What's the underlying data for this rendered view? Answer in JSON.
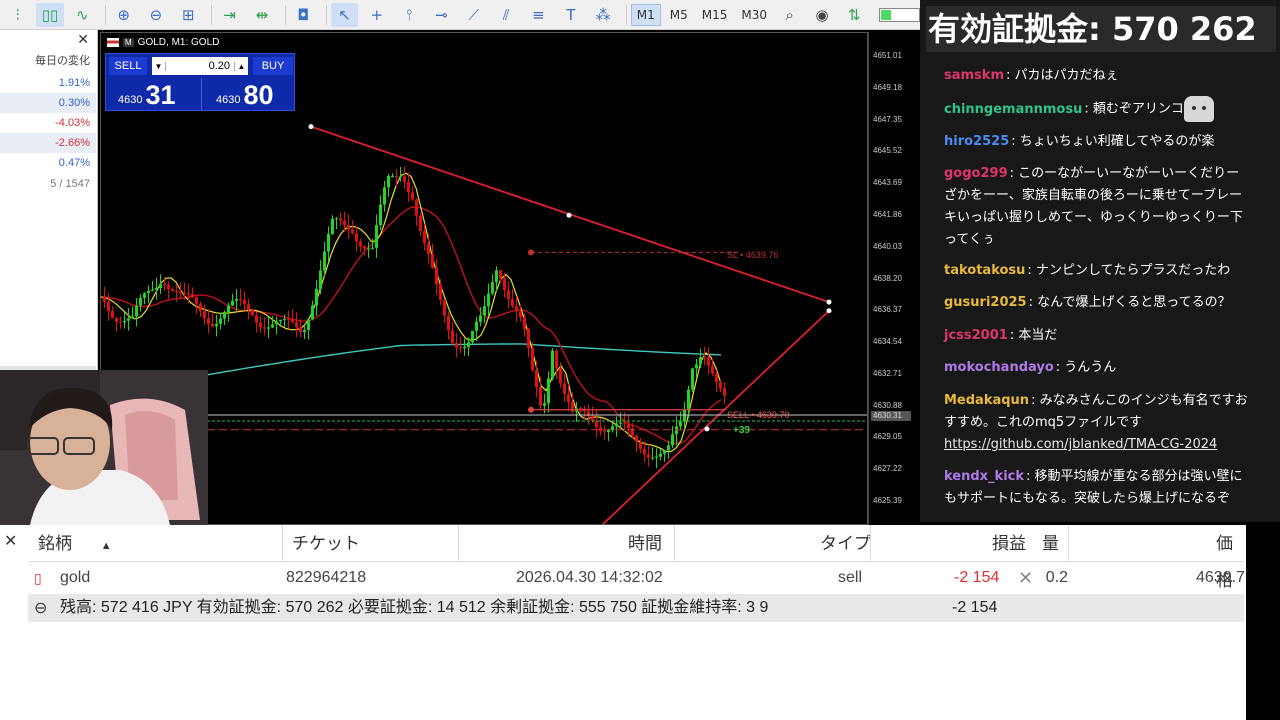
{
  "toolbar": {
    "timeframes": [
      "M1",
      "M5",
      "M15",
      "M30"
    ],
    "active_timeframe": "M1"
  },
  "market_watch": {
    "header": "毎日の変化",
    "rows": [
      "1.91%",
      "0.30%",
      "-4.03%",
      "-2.66%",
      "0.47%"
    ],
    "count": "5 / 1547"
  },
  "chart": {
    "title": "GOLD, M1: GOLD",
    "sell_label": "SELL",
    "buy_label": "BUY",
    "lot": "0.20",
    "sell_small": "4630",
    "sell_big": "31",
    "buy_small": "4630",
    "buy_big": "80",
    "sl_label": "SL • 4639.76",
    "sell_order_label": "SELL • 4630.70",
    "profit_label": "+39",
    "current_price": "4630.31",
    "price_axis": [
      "4651.01",
      "4649.18",
      "4647.35",
      "4645.52",
      "4643.69",
      "4641.86",
      "4640.03",
      "4638.20",
      "4636.37",
      "4634.54",
      "4632.71",
      "4630.88",
      "4629.05",
      "4627.22",
      "4625.39"
    ]
  },
  "chat": {
    "balance_banner": "有効証拠金: 570 262",
    "messages": [
      {
        "user": "samskm",
        "color": "#e0356a",
        "text": "パカはパカだねぇ"
      },
      {
        "user": "chinngemannmosu",
        "color": "#2ec58a",
        "text": "頼むぞアリンコ",
        "emote": true
      },
      {
        "user": "hiro2525",
        "color": "#4a8cf0",
        "text": "ちょいちょい利確してやるのが楽"
      },
      {
        "user": "gogo299",
        "color": "#e0356a",
        "text": "このーながーいーながーいーくだりーざかをーー、家族自転車の後ろーに乗せてーブレーキいっぱい握りしめてー、ゆっくりーゆっくりー下ってくぅ"
      },
      {
        "user": "takotakosu",
        "color": "#e8b93a",
        "text": "ナンピンしてたらプラスだったわ"
      },
      {
        "user": "gusuri2025",
        "color": "#e8b93a",
        "text": "なんで爆上げくると思ってるの？"
      },
      {
        "user": "jcss2001",
        "color": "#e0356a",
        "text": "本当だ"
      },
      {
        "user": "mokochandayo",
        "color": "#b07ae8",
        "text": "うんうん"
      },
      {
        "user": "Medakaqun",
        "color": "#e8b93a",
        "text": "みなみさんこのインジも有名ですおすすめ。これのmq5ファイルです",
        "link": "https://github.com/jblanked/TMA-CG-2024"
      },
      {
        "user": "kendx_kick",
        "color": "#b07ae8",
        "text": "移動平均線が重なる部分は強い壁にもサポートにもなる。突破したら爆上げになるぞ"
      }
    ]
  },
  "positions": {
    "headers": {
      "symbol": "銘柄",
      "ticket": "チケット",
      "time": "時間",
      "type": "タイプ",
      "profit": "損益",
      "volume": "量",
      "price": "価格"
    },
    "row": {
      "symbol": "gold",
      "ticket": "822964218",
      "time": "2026.04.30 14:32:02",
      "type": "sell",
      "profit": "-2 154",
      "volume": "0.2",
      "price": "4630.7"
    },
    "summary": "残高: 572 416 JPY  有効証拠金: 570 262  必要証拠金: 14 512  余剰証拠金: 555 750  証拠金維持率: 3 9",
    "summary_profit": "-2 154"
  },
  "colors": {
    "up_candle": "#22d522",
    "down_candle": "#e01010",
    "ma_red": "#c01020",
    "ma_yellow": "#e8e030",
    "ma_cyan": "#40c8c0",
    "trendline": "#e02030"
  }
}
